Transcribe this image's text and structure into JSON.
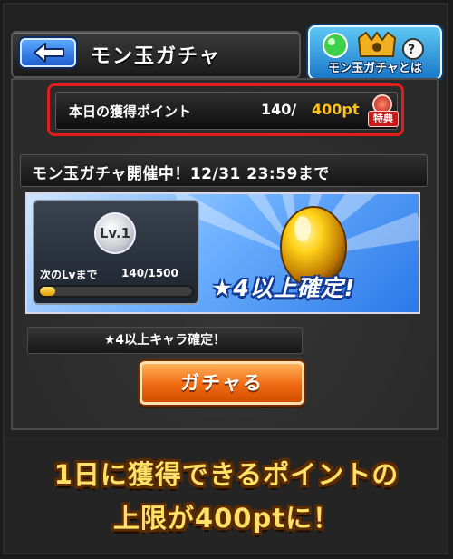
{
  "header": {
    "title": "モン玉ガチャ",
    "back_icon": "left-arrow-icon"
  },
  "guide_button": {
    "label": "モン玉ガチャとは",
    "icon": "monster-ball-help-icon"
  },
  "points": {
    "label": "本日の獲得ポイント",
    "current": "140/",
    "max": "400pt",
    "badge": "特典"
  },
  "event": {
    "text": "モン玉ガチャ開催中！12/31 23:59まで"
  },
  "level": {
    "badge": "Lv.1",
    "next_label": "次のLvまで",
    "next_value": "140/1500",
    "progress_fraction": 0.093
  },
  "banner": {
    "caption": "★4以上確定!"
  },
  "guarantee": {
    "text": "★4以上キャラ確定！"
  },
  "gacha_button": {
    "label": "ガチャる"
  },
  "caption": {
    "line1": "1日に獲得できるポイントの",
    "line2": "上限が400ptに！"
  },
  "colors": {
    "highlight_border": "#e31c1c",
    "points_max": "#ffc21a",
    "caption_text": "#ffe066",
    "button_orange": "#ef6a12"
  }
}
